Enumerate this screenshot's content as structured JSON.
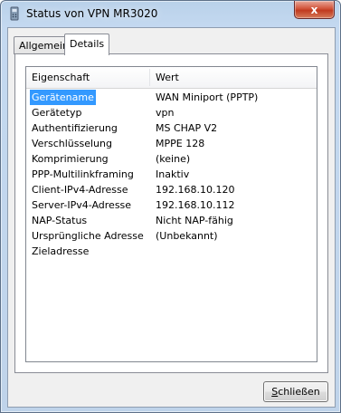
{
  "window": {
    "title": "Status von VPN MR3020",
    "close_glyph": "x",
    "icon": "phone-network-icon"
  },
  "tabs": [
    {
      "label": "Allgemein",
      "active": false
    },
    {
      "label": "Details",
      "active": true
    }
  ],
  "details": {
    "columns": {
      "property": "Eigenschaft",
      "value": "Wert"
    },
    "rows": [
      {
        "property": "Gerätename",
        "value": "WAN Miniport (PPTP)",
        "selected": true
      },
      {
        "property": "Gerätetyp",
        "value": "vpn"
      },
      {
        "property": "Authentifizierung",
        "value": "MS CHAP V2"
      },
      {
        "property": "Verschlüsselung",
        "value": "MPPE 128"
      },
      {
        "property": "Komprimierung",
        "value": "(keine)"
      },
      {
        "property": "PPP-Multilinkframing",
        "value": "Inaktiv"
      },
      {
        "property": "Client-IPv4-Adresse",
        "value": "192.168.10.120"
      },
      {
        "property": "Server-IPv4-Adresse",
        "value": "192.168.10.112"
      },
      {
        "property": "NAP-Status",
        "value": "Nicht NAP-fähig"
      },
      {
        "property": "Ursprüngliche Adresse",
        "value": "(Unbekannt)"
      },
      {
        "property": "Zieladresse",
        "value": ""
      }
    ]
  },
  "footer": {
    "close_label_mnemonic": "S",
    "close_label_rest": "chließen"
  },
  "colors": {
    "selection": "#3399ff",
    "window_frame": "#b9d1ea",
    "close_button": "#c03a1f"
  }
}
